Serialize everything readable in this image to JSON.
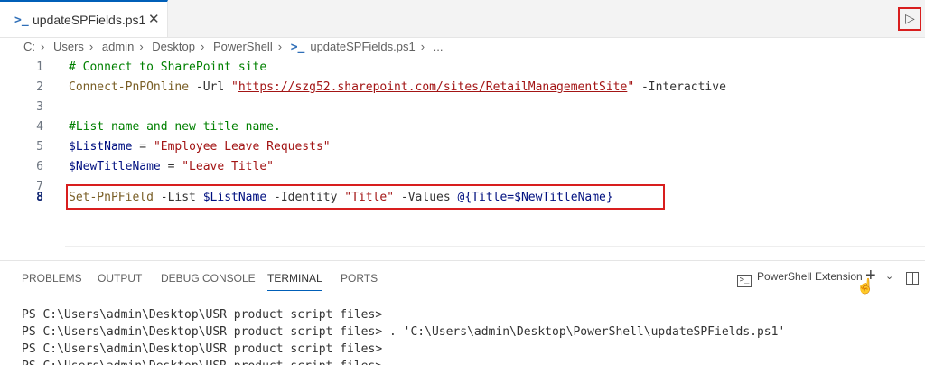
{
  "tab": {
    "icon": "powershell-icon",
    "title": "updateSPFields.ps1",
    "close": "✕"
  },
  "run_icon": "play-icon",
  "breadcrumb": [
    "C:",
    "Users",
    "admin",
    "Desktop",
    "PowerShell",
    "updateSPFields.ps1",
    "..."
  ],
  "editor": {
    "active_line": 8,
    "lines": [
      {
        "n": "1"
      },
      {
        "n": "2"
      },
      {
        "n": "3"
      },
      {
        "n": "4"
      },
      {
        "n": "5"
      },
      {
        "n": "6"
      },
      {
        "n": "7"
      },
      {
        "n": "8"
      }
    ],
    "l1_comment": "# Connect to SharePoint site",
    "l2_cmd": "Connect-PnPOnline",
    "l2_param1": " -Url ",
    "l2_q1": "\"",
    "l2_url": "https://szg52.sharepoint.com/sites/RetailManagementSite",
    "l2_q2": "\"",
    "l2_param2": " -Interactive",
    "l4_comment": "#List name and new title name.",
    "l5_var": "$ListName",
    "l5_eq": " = ",
    "l5_str": "\"Employee Leave Requests\"",
    "l6_var": "$NewTitleName",
    "l6_eq": " = ",
    "l6_str": "\"Leave Title\"",
    "l8_cmd": "Set-PnPField",
    "l8_p1": " -List ",
    "l8_v1": "$ListName",
    "l8_p2": " -Identity ",
    "l8_s1": "\"Title\"",
    "l8_p3": " -Values ",
    "l8_at": "@{",
    "l8_key": "Title=",
    "l8_v2": "$NewTitleName",
    "l8_close": "}"
  },
  "panel": {
    "tabs": [
      "PROBLEMS",
      "OUTPUT",
      "DEBUG CONSOLE",
      "TERMINAL",
      "PORTS"
    ],
    "active_tab": "TERMINAL",
    "terminal_profile": "PowerShell Extension",
    "new_terminal": "+",
    "dropdown": "⌄"
  },
  "terminal": {
    "lines": [
      "PS C:\\Users\\admin\\Desktop\\USR product script files>",
      "PS C:\\Users\\admin\\Desktop\\USR product script files> . 'C:\\Users\\admin\\Desktop\\PowerShell\\updateSPFields.ps1'",
      "PS C:\\Users\\admin\\Desktop\\USR product script files>",
      "PS C:\\Users\\admin\\Desktop\\USR product script files>"
    ]
  }
}
